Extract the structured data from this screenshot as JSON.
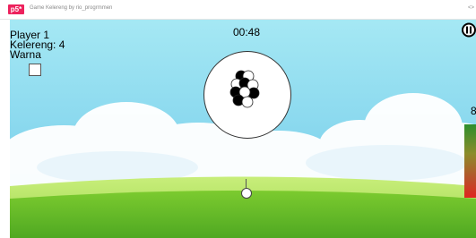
{
  "browser": {
    "logo": "p5*",
    "sketch_title": "Game Kelereng by rio_progrmmen",
    "right_text": "<>"
  },
  "hud": {
    "player": "Player 1",
    "marbles": "Kelereng: 4",
    "color_label": "Warna",
    "timer": "00:48",
    "power_value": "8"
  },
  "marbles_in_ring": [
    {
      "color": "black"
    },
    {
      "color": "white"
    },
    {
      "color": "white"
    },
    {
      "color": "black"
    },
    {
      "color": "white"
    },
    {
      "color": "black"
    },
    {
      "color": "black"
    },
    {
      "color": "white"
    },
    {
      "color": "black"
    },
    {
      "color": "white"
    }
  ],
  "colors": {
    "sky_top": "#9fe6f3",
    "sky_bottom": "#4db8dc",
    "grass_light": "#b7e66c",
    "grass_dark": "#5cb82a",
    "power_top": "#2d8f2d",
    "power_bottom": "#e0261f",
    "p5_brand": "#ed225d"
  }
}
